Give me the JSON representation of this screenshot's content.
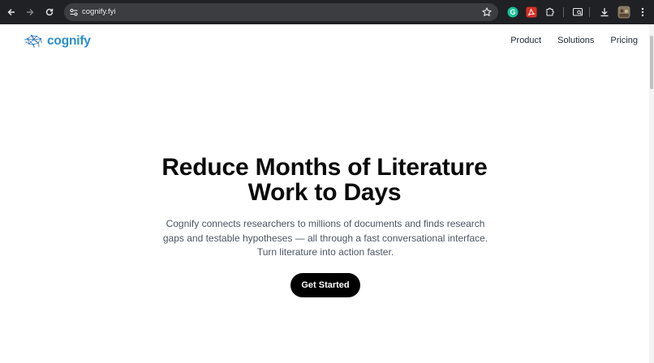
{
  "browser": {
    "url": "cognify.fyi",
    "icons": [
      "back-icon",
      "forward-icon",
      "reload-icon",
      "site-info-icon",
      "bookmark-star-icon",
      "grammarly-extension-icon",
      "acrobat-extension-icon",
      "extensions-puzzle-icon",
      "media-cast-icon",
      "download-icon",
      "profile-avatar",
      "menu-kebab-icon"
    ],
    "colors": {
      "chrome": "#202124",
      "omnibox": "#3c3d41",
      "grammarly": "#15c39a",
      "acrobat": "#d93025"
    }
  },
  "site": {
    "brand": "cognify",
    "brand_color": "#2a8fd0",
    "nav": [
      {
        "label": "Product"
      },
      {
        "label": "Solutions"
      },
      {
        "label": "Pricing"
      }
    ]
  },
  "hero": {
    "title_line1": "Reduce Months of Literature",
    "title_line2": "Work to Days",
    "subtitle": "Cognify connects researchers to millions of documents and finds research gaps and testable hypotheses — all through a fast conversational interface. Turn literature into action faster.",
    "cta_label": "Get Started"
  }
}
